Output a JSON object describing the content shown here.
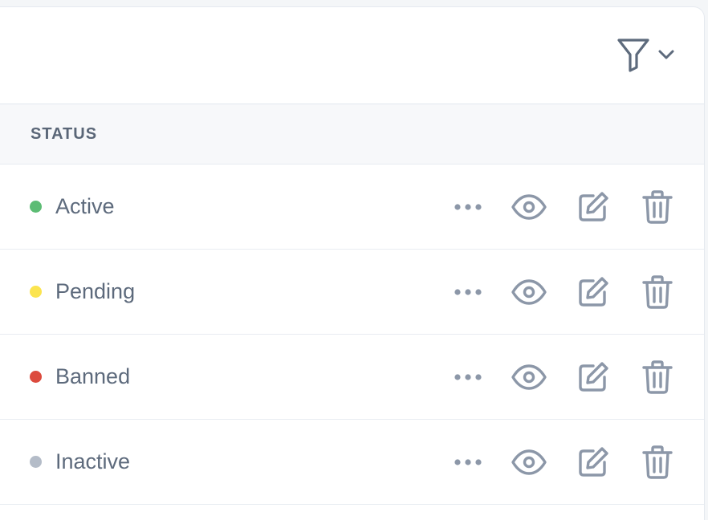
{
  "table": {
    "header": {
      "status_label": "STATUS"
    },
    "rows": [
      {
        "status": "Active",
        "dot_color": "#5cbc74"
      },
      {
        "status": "Pending",
        "dot_color": "#fbe44f"
      },
      {
        "status": "Banned",
        "dot_color": "#dc4a3d"
      },
      {
        "status": "Inactive",
        "dot_color": "#b4bcc8"
      }
    ]
  },
  "toolbar": {
    "filter_icon": "filter-icon",
    "dropdown_icon": "chevron-down-icon"
  },
  "colors": {
    "icon": "#8c97a8",
    "icon_dark": "#5d6a7c"
  }
}
